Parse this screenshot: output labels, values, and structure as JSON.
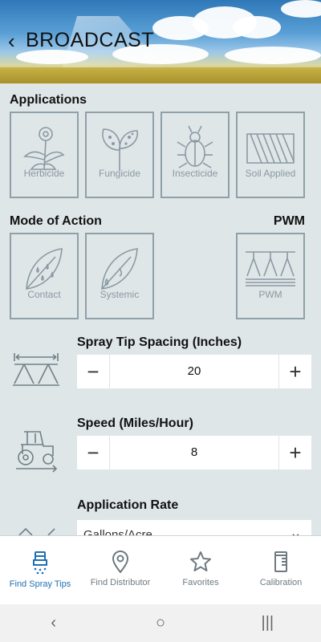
{
  "header": {
    "back_glyph": "‹",
    "title": "BROADCAST"
  },
  "applications": {
    "heading": "Applications",
    "tiles": [
      {
        "label": "Herbicide",
        "icon": "dandelion-icon"
      },
      {
        "label": "Fungicide",
        "icon": "leaf-spots-icon"
      },
      {
        "label": "Insecticide",
        "icon": "beetle-icon"
      },
      {
        "label": "Soil Applied",
        "icon": "plowed-field-icon"
      }
    ]
  },
  "mode_of_action": {
    "heading": "Mode of Action",
    "tiles": [
      {
        "label": "Contact",
        "icon": "leaf-drops-icon"
      },
      {
        "label": "Systemic",
        "icon": "leaf-drip-icon"
      }
    ]
  },
  "pwm": {
    "heading": "PWM",
    "tile_label": "PWM",
    "icon": "spray-nozzles-icon"
  },
  "spray_tip_spacing": {
    "label": "Spray Tip Spacing (Inches)",
    "value": "20",
    "minus": "−",
    "plus": "+"
  },
  "speed": {
    "label": "Speed (Miles/Hour)",
    "value": "8",
    "minus": "−",
    "plus": "+"
  },
  "application_rate": {
    "label": "Application Rate",
    "unit_value": "Gallons/Acre",
    "chev": "⌄"
  },
  "nav": {
    "items": [
      {
        "label": "Find Spray Tips",
        "icon": "spray-tip-icon",
        "active": true
      },
      {
        "label": "Find Distributor",
        "icon": "location-pin-icon",
        "active": false
      },
      {
        "label": "Favorites",
        "icon": "star-icon",
        "active": false
      },
      {
        "label": "Calibration",
        "icon": "measuring-cup-icon",
        "active": false
      }
    ]
  },
  "system_nav": {
    "back": "‹",
    "home": "○",
    "recents": "|||"
  },
  "colors": {
    "background": "#dfe6e8",
    "tile_border": "#8fa0a8",
    "tile_text": "#8a99a2",
    "accent": "#1f6fb4"
  }
}
